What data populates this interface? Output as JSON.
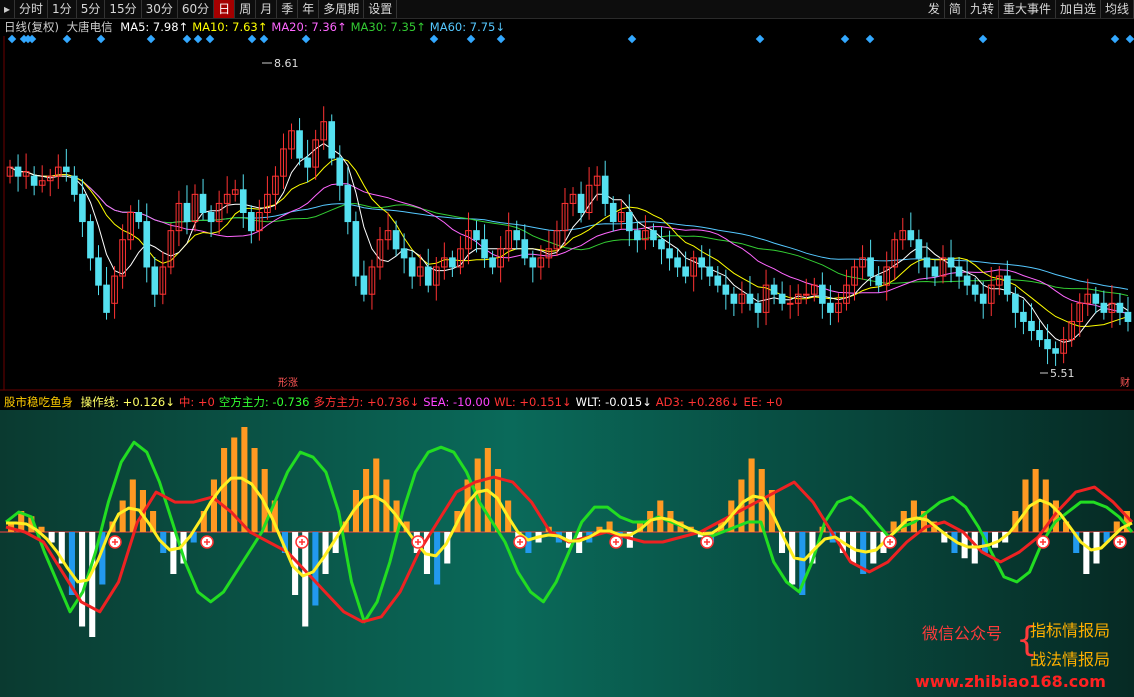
{
  "toolbar": {
    "left": [
      "分时",
      "1分",
      "5分",
      "15分",
      "30分",
      "60分",
      "日",
      "周",
      "月",
      "季",
      "年",
      "多周期",
      "设置"
    ],
    "active": "日",
    "right": [
      "发",
      "简",
      "九转",
      "重大事件",
      "加自选",
      "均线"
    ]
  },
  "main_legend": {
    "title": "日线(复权)",
    "stock": "大唐电信",
    "ma": [
      {
        "label": "MA5: 7.98",
        "arrow": "↑",
        "color": "#ffffff"
      },
      {
        "label": "MA10: 7.63",
        "arrow": "↑",
        "color": "#ffff00"
      },
      {
        "label": "MA20: 7.36",
        "arrow": "↑",
        "color": "#ff66ff"
      },
      {
        "label": "MA30: 7.35",
        "arrow": "↑",
        "color": "#33cc33"
      },
      {
        "label": "MA60: 7.75",
        "arrow": "↓",
        "color": "#55c8ff"
      }
    ]
  },
  "annotations": {
    "high": "8.61",
    "low": "5.51",
    "mark1": "形涨",
    "mark2": "财"
  },
  "sub_legend": {
    "name": "股市稳吃鱼身",
    "items": [
      {
        "label": "操作线: +0.126",
        "arrow": "↓",
        "color": "#ffff66"
      },
      {
        "label": "中: +0",
        "arrow": "",
        "color": "#ff3333"
      },
      {
        "label": "空方主力: -0.736",
        "arrow": "",
        "color": "#33ff33"
      },
      {
        "label": "多方主力: +0.736",
        "arrow": "↓",
        "color": "#ff3333"
      },
      {
        "label": "SEA: -10.00",
        "arrow": "",
        "color": "#ff44ff"
      },
      {
        "label": "WL: +0.151",
        "arrow": "↓",
        "color": "#ff3333"
      },
      {
        "label": "WLT: -0.015",
        "arrow": "↓",
        "color": "#ffffff"
      },
      {
        "label": "AD3: +0.286",
        "arrow": "↓",
        "color": "#ff3333"
      },
      {
        "label": "EE: +0",
        "arrow": "",
        "color": "#ff3333"
      }
    ]
  },
  "watermark": {
    "line1": "微信公众号",
    "line2": "指标情报局",
    "line3": "战法情报局",
    "line4": "www.zhibiao168.com"
  },
  "colors": {
    "up": "#ff3333",
    "down": "#55e0f0",
    "ma5": "#ffffff",
    "ma10": "#ffff00",
    "ma20": "#ff66ff",
    "ma30": "#33cc33",
    "ma60": "#55c8ff",
    "bar_up": "#ff9922",
    "bar_down_a": "#ffffff",
    "bar_down_b": "#2299ee",
    "line_green": "#22dd22",
    "line_red": "#ee2222",
    "line_yellow": "#ffee22"
  },
  "chart_data": [
    {
      "type": "candlestick",
      "ylim": [
        5.2,
        9.0
      ],
      "high_label": 8.61,
      "low_label": 5.51,
      "close": [
        7.6,
        7.5,
        7.55,
        7.4,
        7.45,
        7.5,
        7.6,
        7.55,
        7.3,
        7.0,
        6.6,
        6.3,
        6.0,
        6.4,
        6.8,
        7.1,
        7.0,
        6.5,
        6.2,
        6.5,
        6.9,
        7.2,
        7.0,
        7.3,
        7.1,
        7.0,
        7.2,
        7.3,
        7.35,
        7.1,
        6.9,
        7.1,
        7.3,
        7.5,
        7.8,
        8.0,
        7.7,
        7.6,
        7.9,
        8.1,
        7.7,
        7.4,
        7.0,
        6.4,
        6.2,
        6.5,
        6.8,
        6.9,
        6.7,
        6.6,
        6.4,
        6.5,
        6.3,
        6.5,
        6.6,
        6.5,
        6.7,
        6.9,
        6.8,
        6.6,
        6.5,
        6.7,
        6.9,
        6.8,
        6.6,
        6.5,
        6.6,
        6.7,
        6.9,
        7.2,
        7.3,
        7.1,
        7.4,
        7.5,
        7.2,
        7.0,
        7.1,
        6.9,
        6.8,
        6.9,
        6.8,
        6.7,
        6.6,
        6.5,
        6.4,
        6.6,
        6.5,
        6.4,
        6.3,
        6.2,
        6.1,
        6.2,
        6.1,
        6.0,
        6.3,
        6.2,
        6.1,
        6.1,
        6.2,
        6.2,
        6.3,
        6.1,
        6.0,
        6.1,
        6.3,
        6.5,
        6.6,
        6.4,
        6.3,
        6.5,
        6.8,
        6.9,
        6.8,
        6.6,
        6.5,
        6.4,
        6.6,
        6.5,
        6.4,
        6.3,
        6.2,
        6.1,
        6.3,
        6.4,
        6.2,
        6.0,
        5.9,
        5.8,
        5.7,
        5.6,
        5.55,
        5.7,
        5.9,
        6.1,
        6.2,
        6.1,
        6.0,
        6.1,
        6.0,
        5.9
      ],
      "open": [
        7.5,
        7.6,
        7.5,
        7.5,
        7.4,
        7.45,
        7.5,
        7.6,
        7.5,
        7.3,
        7.0,
        6.6,
        6.3,
        6.1,
        6.4,
        6.8,
        7.1,
        7.0,
        6.5,
        6.2,
        6.5,
        6.9,
        7.2,
        7.0,
        7.3,
        7.1,
        7.0,
        7.2,
        7.3,
        7.35,
        7.1,
        6.9,
        7.1,
        7.3,
        7.5,
        7.8,
        8.0,
        7.7,
        7.6,
        7.9,
        8.1,
        7.7,
        7.4,
        7.0,
        6.4,
        6.2,
        6.5,
        6.8,
        6.9,
        6.7,
        6.6,
        6.4,
        6.5,
        6.3,
        6.5,
        6.6,
        6.5,
        6.7,
        6.9,
        6.8,
        6.6,
        6.5,
        6.7,
        6.9,
        6.8,
        6.6,
        6.5,
        6.6,
        6.7,
        6.9,
        7.2,
        7.3,
        7.1,
        7.4,
        7.5,
        7.2,
        7.0,
        7.1,
        6.9,
        6.8,
        6.9,
        6.8,
        6.7,
        6.6,
        6.5,
        6.4,
        6.6,
        6.5,
        6.4,
        6.3,
        6.2,
        6.1,
        6.2,
        6.1,
        6.0,
        6.3,
        6.2,
        6.1,
        6.1,
        6.2,
        6.2,
        6.3,
        6.1,
        6.0,
        6.1,
        6.3,
        6.5,
        6.6,
        6.4,
        6.3,
        6.5,
        6.8,
        6.9,
        6.8,
        6.6,
        6.5,
        6.4,
        6.6,
        6.5,
        6.4,
        6.3,
        6.2,
        6.1,
        6.3,
        6.4,
        6.2,
        6.0,
        5.9,
        5.8,
        5.7,
        5.6,
        5.55,
        5.7,
        5.9,
        6.1,
        6.2,
        6.1,
        6.0,
        6.1,
        6.0
      ]
    },
    {
      "type": "bar",
      "note_series": "oscillator histogram + three lines",
      "ylim": [
        -1.0,
        1.0
      ],
      "hist": [
        0.1,
        0.2,
        0.15,
        0.05,
        -0.1,
        -0.3,
        -0.6,
        -0.9,
        -1.0,
        -0.5,
        0.1,
        0.3,
        0.5,
        0.4,
        0.2,
        -0.2,
        -0.4,
        -0.3,
        -0.1,
        0.2,
        0.5,
        0.8,
        0.9,
        1.0,
        0.8,
        0.6,
        0.3,
        -0.2,
        -0.6,
        -0.9,
        -0.7,
        -0.4,
        -0.2,
        0.1,
        0.4,
        0.6,
        0.7,
        0.5,
        0.3,
        0.1,
        -0.2,
        -0.4,
        -0.5,
        -0.3,
        0.2,
        0.5,
        0.7,
        0.8,
        0.6,
        0.3,
        -0.1,
        -0.2,
        -0.1,
        0.05,
        -0.1,
        -0.15,
        -0.2,
        -0.1,
        0.05,
        0.1,
        -0.1,
        -0.15,
        0.1,
        0.2,
        0.3,
        0.2,
        0.1,
        0.05,
        -0.05,
        -0.1,
        0.1,
        0.3,
        0.5,
        0.7,
        0.6,
        0.4,
        -0.2,
        -0.5,
        -0.6,
        -0.3,
        0.05,
        -0.1,
        -0.2,
        -0.3,
        -0.4,
        -0.3,
        -0.2,
        0.1,
        0.2,
        0.3,
        0.2,
        0.1,
        -0.1,
        -0.2,
        -0.25,
        -0.3,
        -0.2,
        -0.15,
        -0.1,
        0.2,
        0.5,
        0.6,
        0.5,
        0.3,
        0.1,
        -0.2,
        -0.4,
        -0.3,
        -0.1,
        0.1,
        0.2
      ],
      "green": [
        0.1,
        0.2,
        0.15,
        -0.2,
        -0.5,
        -0.8,
        -0.6,
        -0.2,
        0.3,
        0.7,
        0.9,
        0.8,
        0.5,
        0.1,
        -0.3,
        -0.6,
        -0.7,
        -0.6,
        -0.4,
        -0.2,
        0.0,
        0.3,
        0.6,
        0.8,
        0.75,
        0.6,
        0.2,
        -0.5,
        -0.9,
        -0.7,
        -0.3,
        0.2,
        0.6,
        0.8,
        0.85,
        0.8,
        0.6,
        0.3,
        0.1,
        -0.1,
        -0.4,
        -0.6,
        -0.7,
        -0.5,
        -0.2,
        0.1,
        0.25,
        0.25,
        0.15,
        0.1,
        0.1,
        0.15,
        0.1,
        0.05,
        0.0,
        -0.05,
        0.0,
        0.05,
        0.1,
        0.1,
        -0.3,
        -0.5,
        -0.6,
        -0.3,
        0.1,
        0.3,
        0.35,
        0.25,
        0.1,
        -0.05,
        0.05,
        0.1,
        0.2,
        0.3,
        0.35,
        0.25,
        0.05,
        -0.2,
        -0.45,
        -0.5,
        -0.4,
        -0.1,
        0.1,
        0.2,
        0.3,
        0.3,
        0.25,
        0.15,
        0.0
      ],
      "red": [
        0.05,
        0.0,
        -0.1,
        -0.4,
        -0.7,
        -0.8,
        -0.5,
        0.1,
        0.4,
        0.3,
        0.3,
        0.35,
        0.2,
        0.0,
        -0.1,
        -0.2,
        -0.4,
        -0.6,
        -0.8,
        -0.9,
        -0.85,
        -0.6,
        -0.2,
        0.1,
        0.4,
        0.5,
        0.55,
        0.5,
        0.3,
        0.0,
        -0.1,
        -0.05,
        0.0,
        -0.05,
        -0.1,
        -0.1,
        -0.05,
        0.0,
        0.1,
        0.2,
        0.3,
        0.4,
        0.5,
        0.3,
        0.0,
        -0.3,
        -0.4,
        -0.3,
        -0.1,
        0.05,
        0.1,
        0.0,
        -0.2,
        -0.3,
        -0.2,
        -0.05,
        0.2,
        0.4,
        0.45,
        0.3,
        0.1
      ]
    }
  ]
}
